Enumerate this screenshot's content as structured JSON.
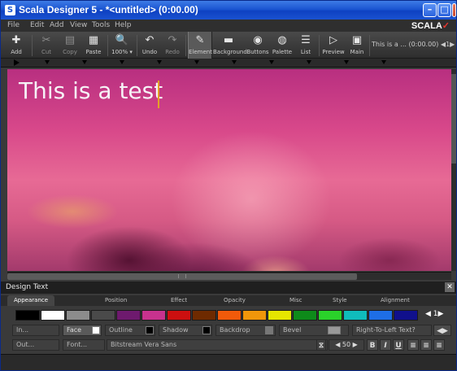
{
  "window": {
    "title": "Scala Designer 5 - *<untitled> (0:00.00)"
  },
  "menu": [
    "File",
    "Edit",
    "Add",
    "View",
    "Tools",
    "Help"
  ],
  "brand": {
    "name": "SCALA",
    "mark": "✓"
  },
  "toolbar": [
    {
      "label": "Add",
      "icon": "plus-icon",
      "glyph": "✚",
      "state": "normal"
    },
    {
      "label": "Cut",
      "icon": "scissors-icon",
      "glyph": "✂",
      "state": "dim"
    },
    {
      "label": "Copy",
      "icon": "copy-icon",
      "glyph": "▤",
      "state": "dim"
    },
    {
      "label": "Paste",
      "icon": "paste-icon",
      "glyph": "▦",
      "state": "normal"
    },
    {
      "label": "100% ▾",
      "icon": "zoom-icon",
      "glyph": "🔍",
      "state": "normal"
    },
    {
      "label": "Undo",
      "icon": "undo-icon",
      "glyph": "↶",
      "state": "normal"
    },
    {
      "label": "Redo",
      "icon": "redo-icon",
      "glyph": "↷",
      "state": "dim"
    },
    {
      "label": "Element",
      "icon": "pen-icon",
      "glyph": "✎",
      "state": "active"
    },
    {
      "label": "Background",
      "icon": "background-icon",
      "glyph": "▬",
      "state": "normal"
    },
    {
      "label": "Buttons",
      "icon": "buttons-icon",
      "glyph": "◉",
      "state": "normal"
    },
    {
      "label": "Palette",
      "icon": "palette-icon",
      "glyph": "◍",
      "state": "normal"
    },
    {
      "label": "List",
      "icon": "list-icon",
      "glyph": "☰",
      "state": "normal"
    },
    {
      "label": "Preview",
      "icon": "play-icon",
      "glyph": "▷",
      "state": "normal"
    },
    {
      "label": "Main",
      "icon": "main-icon",
      "glyph": "▣",
      "state": "normal"
    }
  ],
  "playinfo": "This is a ... (0:00.00) ◀1▶",
  "canvas": {
    "text": "This is a test"
  },
  "panel": {
    "title": "Design Text",
    "tabs": [
      "Appearance",
      "Position",
      "Effect",
      "Opacity",
      "Misc",
      "Style",
      "Alignment"
    ],
    "active_tab": "Appearance",
    "palette": [
      "#000000",
      "#ffffff",
      "#8c8c8c",
      "#4a4a4a",
      "#6e1a6e",
      "#c8328e",
      "#cc1010",
      "#6e2a00",
      "#f05a0a",
      "#f0960a",
      "#e6e600",
      "#0e8a1a",
      "#2ad22a",
      "#10bcbc",
      "#1e6ee6",
      "#10108c"
    ],
    "palette_nav": "◀ 1▶",
    "row1": {
      "in": "In...",
      "face": "Face",
      "outline": "Outline",
      "shadow": "Shadow",
      "backdrop": "Backdrop",
      "bevel": "Bevel",
      "rtl": "Right-To-Left Text?",
      "rtl_nav": "◀▶"
    },
    "row2": {
      "out": "Out...",
      "font_btn": "Font...",
      "font_name": "Bitstream Vera Sans",
      "size": "◀ 50 ▶",
      "bold": "B",
      "italic": "I",
      "underline": "U"
    }
  }
}
